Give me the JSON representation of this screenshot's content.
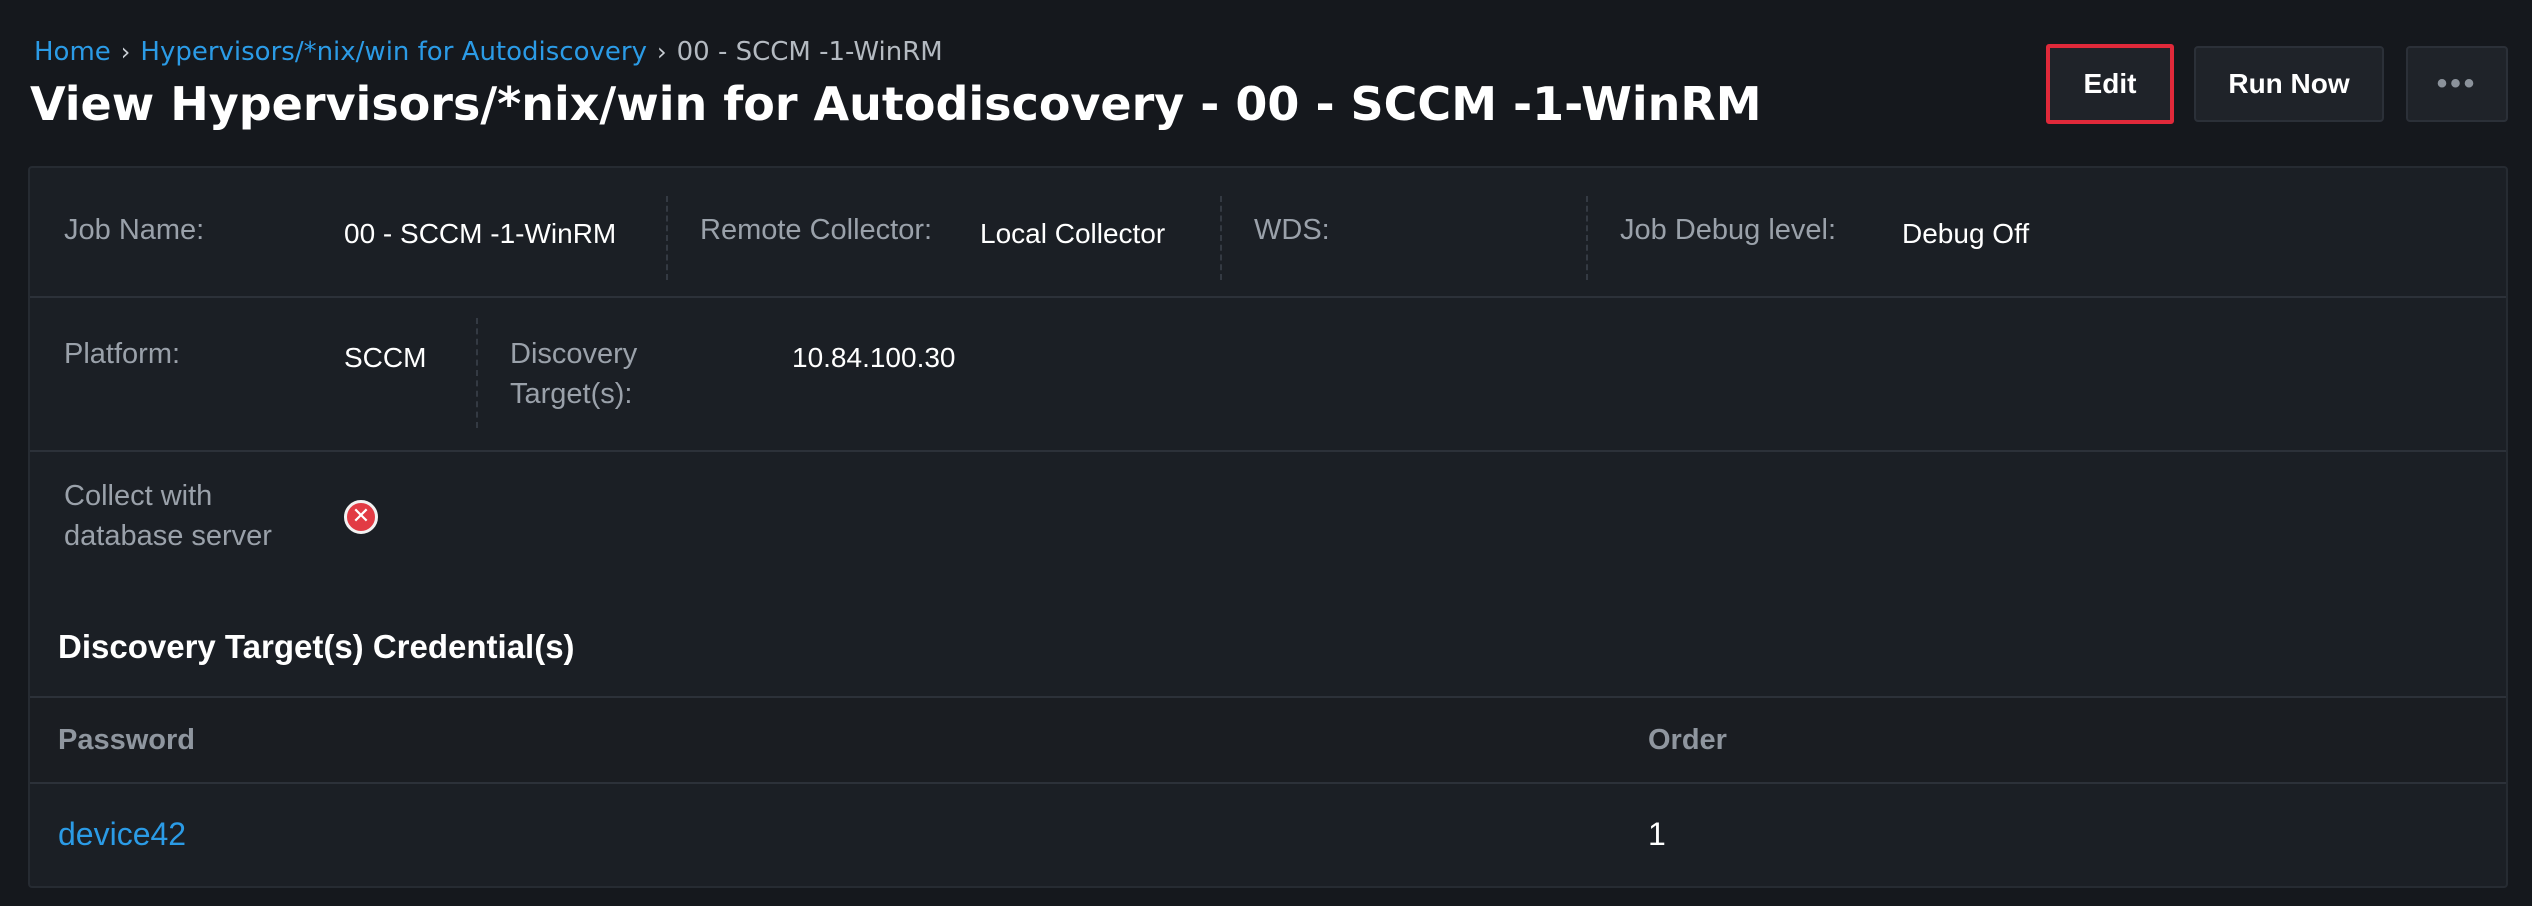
{
  "breadcrumb": {
    "home": "Home",
    "section": "Hypervisors/*nix/win for Autodiscovery",
    "separator": "›",
    "current": "00 - SCCM -1-WinRM"
  },
  "page_title": "View Hypervisors/*nix/win for Autodiscovery - 00 - SCCM -1-WinRM",
  "actions": {
    "edit": "Edit",
    "run_now": "Run Now",
    "more": "•••"
  },
  "details": {
    "job_name_label": "Job Name:",
    "job_name": "00 - SCCM -1-WinRM",
    "remote_collector_label": "Remote Collector:",
    "remote_collector": "Local Collector",
    "wds_label": "WDS:",
    "wds": "",
    "job_debug_label": "Job Debug level:",
    "job_debug": "Debug Off",
    "platform_label": "Platform:",
    "platform": "SCCM",
    "discovery_targets_label_line1": "Discovery",
    "discovery_targets_label_line2": "Target(s):",
    "discovery_targets": "10.84.100.30",
    "collect_db_label_line1": "Collect with",
    "collect_db_label_line2": "database server",
    "collect_db_icon": "x-circle-icon",
    "collect_db_status_color": "#e23b44"
  },
  "credentials": {
    "title": "Discovery Target(s) Credential(s)",
    "columns": [
      "Password",
      "Order"
    ],
    "rows": [
      {
        "password": "device42",
        "order": "1"
      }
    ]
  },
  "colors": {
    "accent_link": "#2b9be6",
    "edit_highlight": "#e0293a",
    "background": "#15181d"
  }
}
